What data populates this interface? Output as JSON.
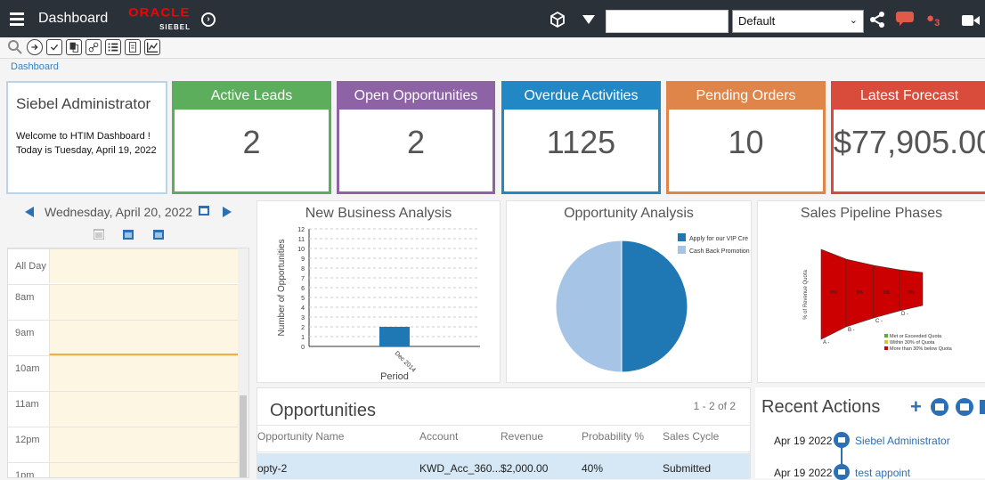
{
  "header": {
    "title": "Dashboard",
    "logo_top": "ORACLE",
    "logo_bottom": "SIEBEL",
    "search_value": "",
    "view_selected": "Default",
    "notif_count": "3"
  },
  "breadcrumb": "Dashboard",
  "welcome": {
    "name": "Siebel Administrator",
    "line1": "Welcome to HTIM Dashboard !",
    "line2": "Today is Tuesday, April 19, 2022"
  },
  "kpis": [
    {
      "label": "Active Leads",
      "value": "2",
      "color": "#5cad5c"
    },
    {
      "label": "Open Opportunities",
      "value": "2",
      "color": "#8e63a5"
    },
    {
      "label": "Overdue Activities",
      "value": "1125",
      "color": "#2288c5"
    },
    {
      "label": "Pending Orders",
      "value": "10",
      "color": "#e0854a"
    },
    {
      "label": "Latest Forecast",
      "value": "$77,905.00",
      "color": "#d94b3b"
    }
  ],
  "calendar": {
    "date": "Wednesday, April 20, 2022",
    "all_day": "All Day",
    "times": [
      "8am",
      "9am",
      "10am",
      "11am",
      "12pm",
      "1pm"
    ]
  },
  "new_business": {
    "title": "New Business Analysis",
    "ylabel": "Number of Opportunities",
    "xlabel": "Period"
  },
  "opportunity_analysis": {
    "title": "Opportunity Analysis",
    "legend": [
      "Apply for our VIP Cre",
      "Cash Back Promotion"
    ]
  },
  "pipeline": {
    "title": "Sales Pipeline Phases",
    "ylabel": "% of Revenue Quota",
    "stage_labels": [
      "A -",
      "B -",
      "C -",
      "D -"
    ],
    "pct_labels": [
      "0%",
      "0%",
      "0%",
      "0%"
    ],
    "legend": [
      "Met or Exceeded Quota",
      "Within 30% of Quota",
      "More than 30% below Quota"
    ]
  },
  "opportunities": {
    "title": "Opportunities",
    "count": "1 - 2 of 2",
    "columns": [
      "Opportunity Name",
      "Account",
      "Revenue",
      "Probability %",
      "Sales Cycle"
    ],
    "rows": [
      [
        "opty-2",
        "KWD_Acc_360...",
        "$2,000.00",
        "40%",
        "Submitted"
      ]
    ]
  },
  "recent_actions": {
    "title": "Recent Actions",
    "items": [
      {
        "date": "Apr 19 2022",
        "text": "Siebel Administrator"
      },
      {
        "date": "Apr 19 2022",
        "text": "test appoint"
      }
    ]
  },
  "chart_data": [
    {
      "type": "bar",
      "title": "New Business Analysis",
      "xlabel": "Period",
      "ylabel": "Number of Opportunities",
      "categories": [
        "Dec 2014"
      ],
      "values": [
        2
      ],
      "ylim": [
        0,
        12
      ],
      "grid": true,
      "colors": [
        "#1f78b4"
      ]
    },
    {
      "type": "pie",
      "title": "Opportunity Analysis",
      "categories": [
        "Apply for our VIP Cre",
        "Cash Back Promotion"
      ],
      "values": [
        50,
        50
      ],
      "colors": [
        "#1f78b4",
        "#a6c4e6"
      ],
      "legend": "top-right"
    },
    {
      "type": "bar",
      "title": "Sales Pipeline Phases",
      "ylabel": "% of Revenue Quota",
      "categories": [
        "A -",
        "B -",
        "C -",
        "D -"
      ],
      "values": [
        0,
        0,
        0,
        0
      ],
      "colors": [
        "#cc0000"
      ],
      "legend": "bottom-right"
    }
  ]
}
